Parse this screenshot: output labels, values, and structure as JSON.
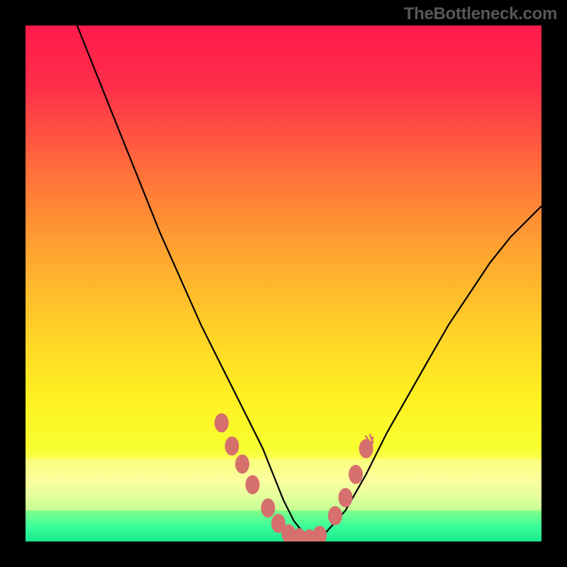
{
  "watermark": "TheBottleneck.com",
  "colors": {
    "frame": "#000000",
    "gradient_stops": [
      {
        "offset": 0.0,
        "color": "#ff1a4b"
      },
      {
        "offset": 0.12,
        "color": "#ff2f4a"
      },
      {
        "offset": 0.28,
        "color": "#ff6e3a"
      },
      {
        "offset": 0.44,
        "color": "#ffa531"
      },
      {
        "offset": 0.6,
        "color": "#ffd327"
      },
      {
        "offset": 0.72,
        "color": "#fff022"
      },
      {
        "offset": 0.82,
        "color": "#f8ff30"
      },
      {
        "offset": 0.88,
        "color": "#fdffa0"
      },
      {
        "offset": 0.91,
        "color": "#ccffa0"
      },
      {
        "offset": 0.94,
        "color": "#7fff8a"
      },
      {
        "offset": 0.97,
        "color": "#3dff9a"
      },
      {
        "offset": 1.0,
        "color": "#17e88e"
      }
    ],
    "curve": "#000000",
    "marker_fill": "#d6706d",
    "marker_stroke": "#d6706d",
    "highlight_bar_top": "#fcff9a",
    "highlight_bar_bottom": "#d9ffb0"
  },
  "chart_data": {
    "type": "line",
    "title": "",
    "xlabel": "",
    "ylabel": "",
    "xlim": [
      0,
      100
    ],
    "ylim": [
      0,
      100
    ],
    "grid": false,
    "legend": false,
    "series": [
      {
        "name": "bottleneck-curve",
        "x": [
          10,
          14,
          18,
          22,
          26,
          30,
          34,
          38,
          42,
          46,
          48,
          50,
          52,
          54,
          56,
          58,
          62,
          66,
          70,
          74,
          78,
          82,
          86,
          90,
          94,
          98,
          100
        ],
        "y": [
          100,
          90,
          80,
          70,
          60,
          51,
          42,
          34,
          26,
          18,
          13,
          8,
          4,
          1.5,
          0.5,
          1.5,
          6,
          13,
          21,
          28,
          35,
          42,
          48,
          54,
          59,
          63,
          65
        ]
      }
    ],
    "markers": {
      "name": "highlight-points",
      "x": [
        38,
        40,
        42,
        44,
        47,
        49,
        51,
        53,
        55,
        57,
        60,
        62,
        64,
        66
      ],
      "y": [
        23,
        18.5,
        15,
        11,
        6.5,
        3.5,
        1.5,
        0.7,
        0.5,
        1.2,
        5,
        8.5,
        13,
        18
      ]
    }
  }
}
